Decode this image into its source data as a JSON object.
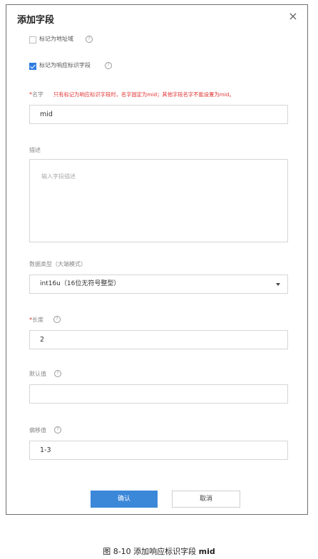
{
  "dialog": {
    "title": "添加字段",
    "close_symbol": "×"
  },
  "checkbox_address": {
    "label": "标记为地址域",
    "checked": false
  },
  "checkbox_response": {
    "label": "标记为响应标识字段",
    "checked": true
  },
  "name_field": {
    "required_mark": "*",
    "label": "名字",
    "warning": "只有标记为响应标识字段时，名字固定为mid；其他字段名字不能设置为mid。",
    "value": "mid"
  },
  "description_field": {
    "label": "描述",
    "placeholder": "输入字段描述"
  },
  "datatype_field": {
    "label": "数据类型（大端模式）",
    "selected": "int16u（16位无符号整型）"
  },
  "length_field": {
    "required_mark": "*",
    "label": "长度",
    "value": "2"
  },
  "default_field": {
    "label": "默认值",
    "value": ""
  },
  "offset_field": {
    "label": "偏移值",
    "value": "1-3"
  },
  "buttons": {
    "confirm": "确认",
    "cancel": "取消"
  },
  "caption": {
    "prefix": "图  8-10 添加响应标识字段 ",
    "bold": "mid"
  },
  "colors": {
    "primary": "#3b87d8",
    "checkbox_checked": "#2f7de1",
    "required": "#e03030"
  },
  "icons": [
    "close-icon",
    "help-icon",
    "chevron-down-icon",
    "check-icon"
  ]
}
